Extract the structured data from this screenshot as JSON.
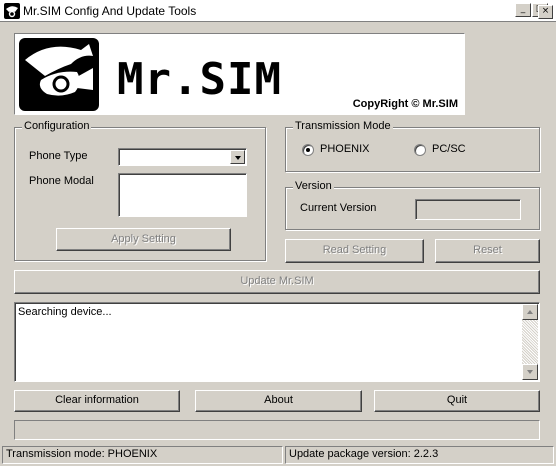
{
  "window": {
    "title": "Mr.SIM Config And Update Tools",
    "minimize_glyph": "_",
    "maximize_glyph": "□",
    "close_glyph": "×"
  },
  "banner": {
    "brand": "Mr.SIM",
    "copyright": "CopyRight © Mr.SIM"
  },
  "configuration": {
    "title": "Configuration",
    "phone_type_label": "Phone Type",
    "phone_type_value": "",
    "phone_modal_label": "Phone Modal",
    "phone_modal_value": "",
    "apply_label": "Apply Setting"
  },
  "transmission": {
    "title": "Transmission Mode",
    "options": [
      {
        "label": "PHOENIX",
        "checked": true
      },
      {
        "label": "PC/SC",
        "checked": false
      }
    ]
  },
  "version": {
    "title": "Version",
    "current_label": "Current Version",
    "current_value": ""
  },
  "actions": {
    "read_label": "Read Setting",
    "reset_label": "Reset",
    "update_label": "Update Mr.SIM",
    "clear_label": "Clear information",
    "about_label": "About",
    "quit_label": "Quit"
  },
  "log": {
    "text": "Searching device..."
  },
  "progress": {
    "value": 0
  },
  "status": {
    "mode": "Transmission mode: PHOENIX",
    "package": "Update package version: 2.2.3"
  }
}
